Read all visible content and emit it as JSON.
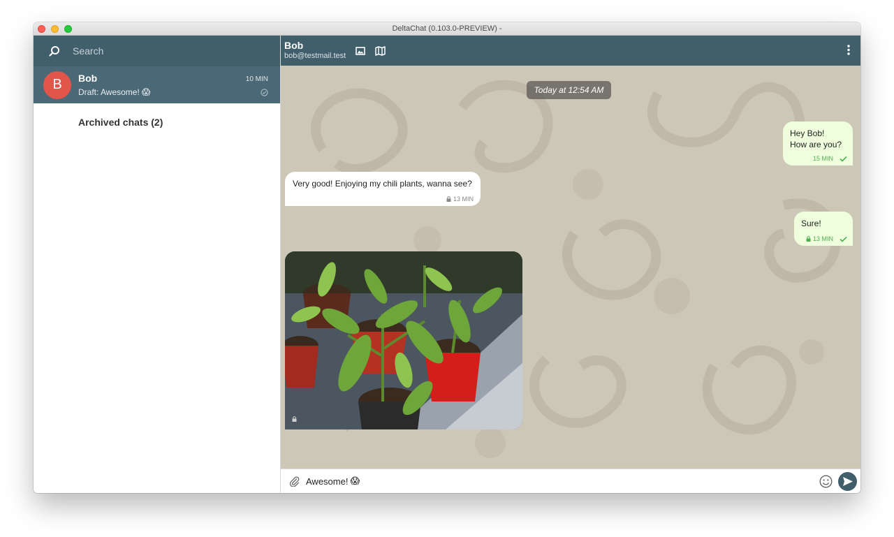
{
  "window": {
    "title": "DeltaChat (0.103.0-PREVIEW) -"
  },
  "sidebar": {
    "search_placeholder": "Search",
    "chats": [
      {
        "avatar_letter": "B",
        "name": "Bob",
        "preview": "Draft: Awesome!",
        "preview_emoji": "😱",
        "time": "10 MIN",
        "status_icon": "check-circle-icon"
      }
    ],
    "archived_label": "Archived chats (2)"
  },
  "header": {
    "name": "Bob",
    "email": "bob@testmail.test",
    "icons": [
      "gallery-icon",
      "map-icon",
      "more-vertical-icon"
    ]
  },
  "conversation": {
    "date_chip": "Today at 12:54 AM",
    "messages": [
      {
        "direction": "out",
        "text_line1": "Hey Bob!",
        "text_line2": "How are you?",
        "time": "15 MIN",
        "delivered": true
      },
      {
        "direction": "in",
        "text": "Very good! Enjoying my chili plants, wanna see?",
        "time": "13 MIN",
        "encrypted": true
      },
      {
        "direction": "out",
        "text": "Sure!",
        "time": "13 MIN",
        "encrypted": true,
        "delivered": true
      },
      {
        "direction": "in",
        "type": "image",
        "subject": "chili plants in pots",
        "encrypted": true
      }
    ]
  },
  "composer": {
    "value": "Awesome!",
    "value_emoji": "😱",
    "icons": [
      "paperclip-icon",
      "smiley-icon",
      "send-icon"
    ]
  },
  "colors": {
    "header_bg": "#415e6b",
    "selected_chat_bg": "#4a6875",
    "avatar_bg": "#e3554b",
    "outgoing_bubble": "#efffde",
    "incoming_bubble": "#ffffff",
    "chat_bg": "#cdc7b8",
    "tick_green": "#4fae4e"
  }
}
